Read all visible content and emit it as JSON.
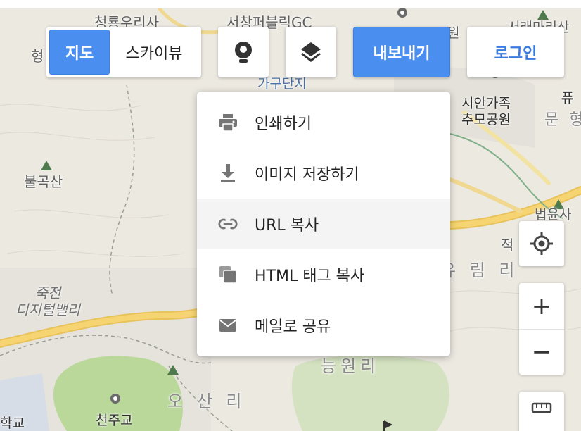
{
  "map": {
    "labels": [
      {
        "id": "cheongryong",
        "text": "청룡우리사"
      },
      {
        "id": "seochang",
        "text": "서창퍼블릭GC"
      },
      {
        "id": "hyeong",
        "text": "형"
      },
      {
        "id": "gagu",
        "text": "가구단지"
      },
      {
        "id": "sian",
        "text": "시안가족\n추모공원"
      },
      {
        "id": "munhyeong",
        "text": "문 형"
      },
      {
        "id": "bulgoksan",
        "text": "불곡산"
      },
      {
        "id": "jukjeon",
        "text": "죽전\n디지털밸리"
      },
      {
        "id": "yurim",
        "text": "유 림 리"
      },
      {
        "id": "neungwon",
        "text": "능원리"
      },
      {
        "id": "osan",
        "text": "오 산 리"
      },
      {
        "id": "cheonjugyo",
        "text": "천주교"
      },
      {
        "id": "hakgyo",
        "text": "학교"
      },
      {
        "id": "jeok",
        "text": "적"
      },
      {
        "id": "beobyunsa",
        "text": "법윤사"
      },
      {
        "id": "seoraksan",
        "text": "서래마리산"
      },
      {
        "id": "park_right",
        "text": "퓨"
      },
      {
        "id": "won",
        "text": "원"
      }
    ]
  },
  "maptype": {
    "map_label": "지도",
    "skyview_label": "스카이뷰"
  },
  "toolbar": {
    "export_label": "내보내기",
    "login_label": "로그인"
  },
  "export_menu": {
    "items": [
      {
        "label": "인쇄하기",
        "icon": "print-icon"
      },
      {
        "label": "이미지 저장하기",
        "icon": "download-icon"
      },
      {
        "label": "URL 복사",
        "icon": "link-icon"
      },
      {
        "label": "HTML 태그 복사",
        "icon": "copy-icon"
      },
      {
        "label": "메일로 공유",
        "icon": "mail-icon"
      }
    ]
  },
  "controls": {
    "zoom_in": "+",
    "zoom_out": "−"
  },
  "colors": {
    "accent": "#4a8ff0",
    "login_text": "#3b7be0",
    "road": "#f6d472",
    "park": "#b9d89a"
  }
}
